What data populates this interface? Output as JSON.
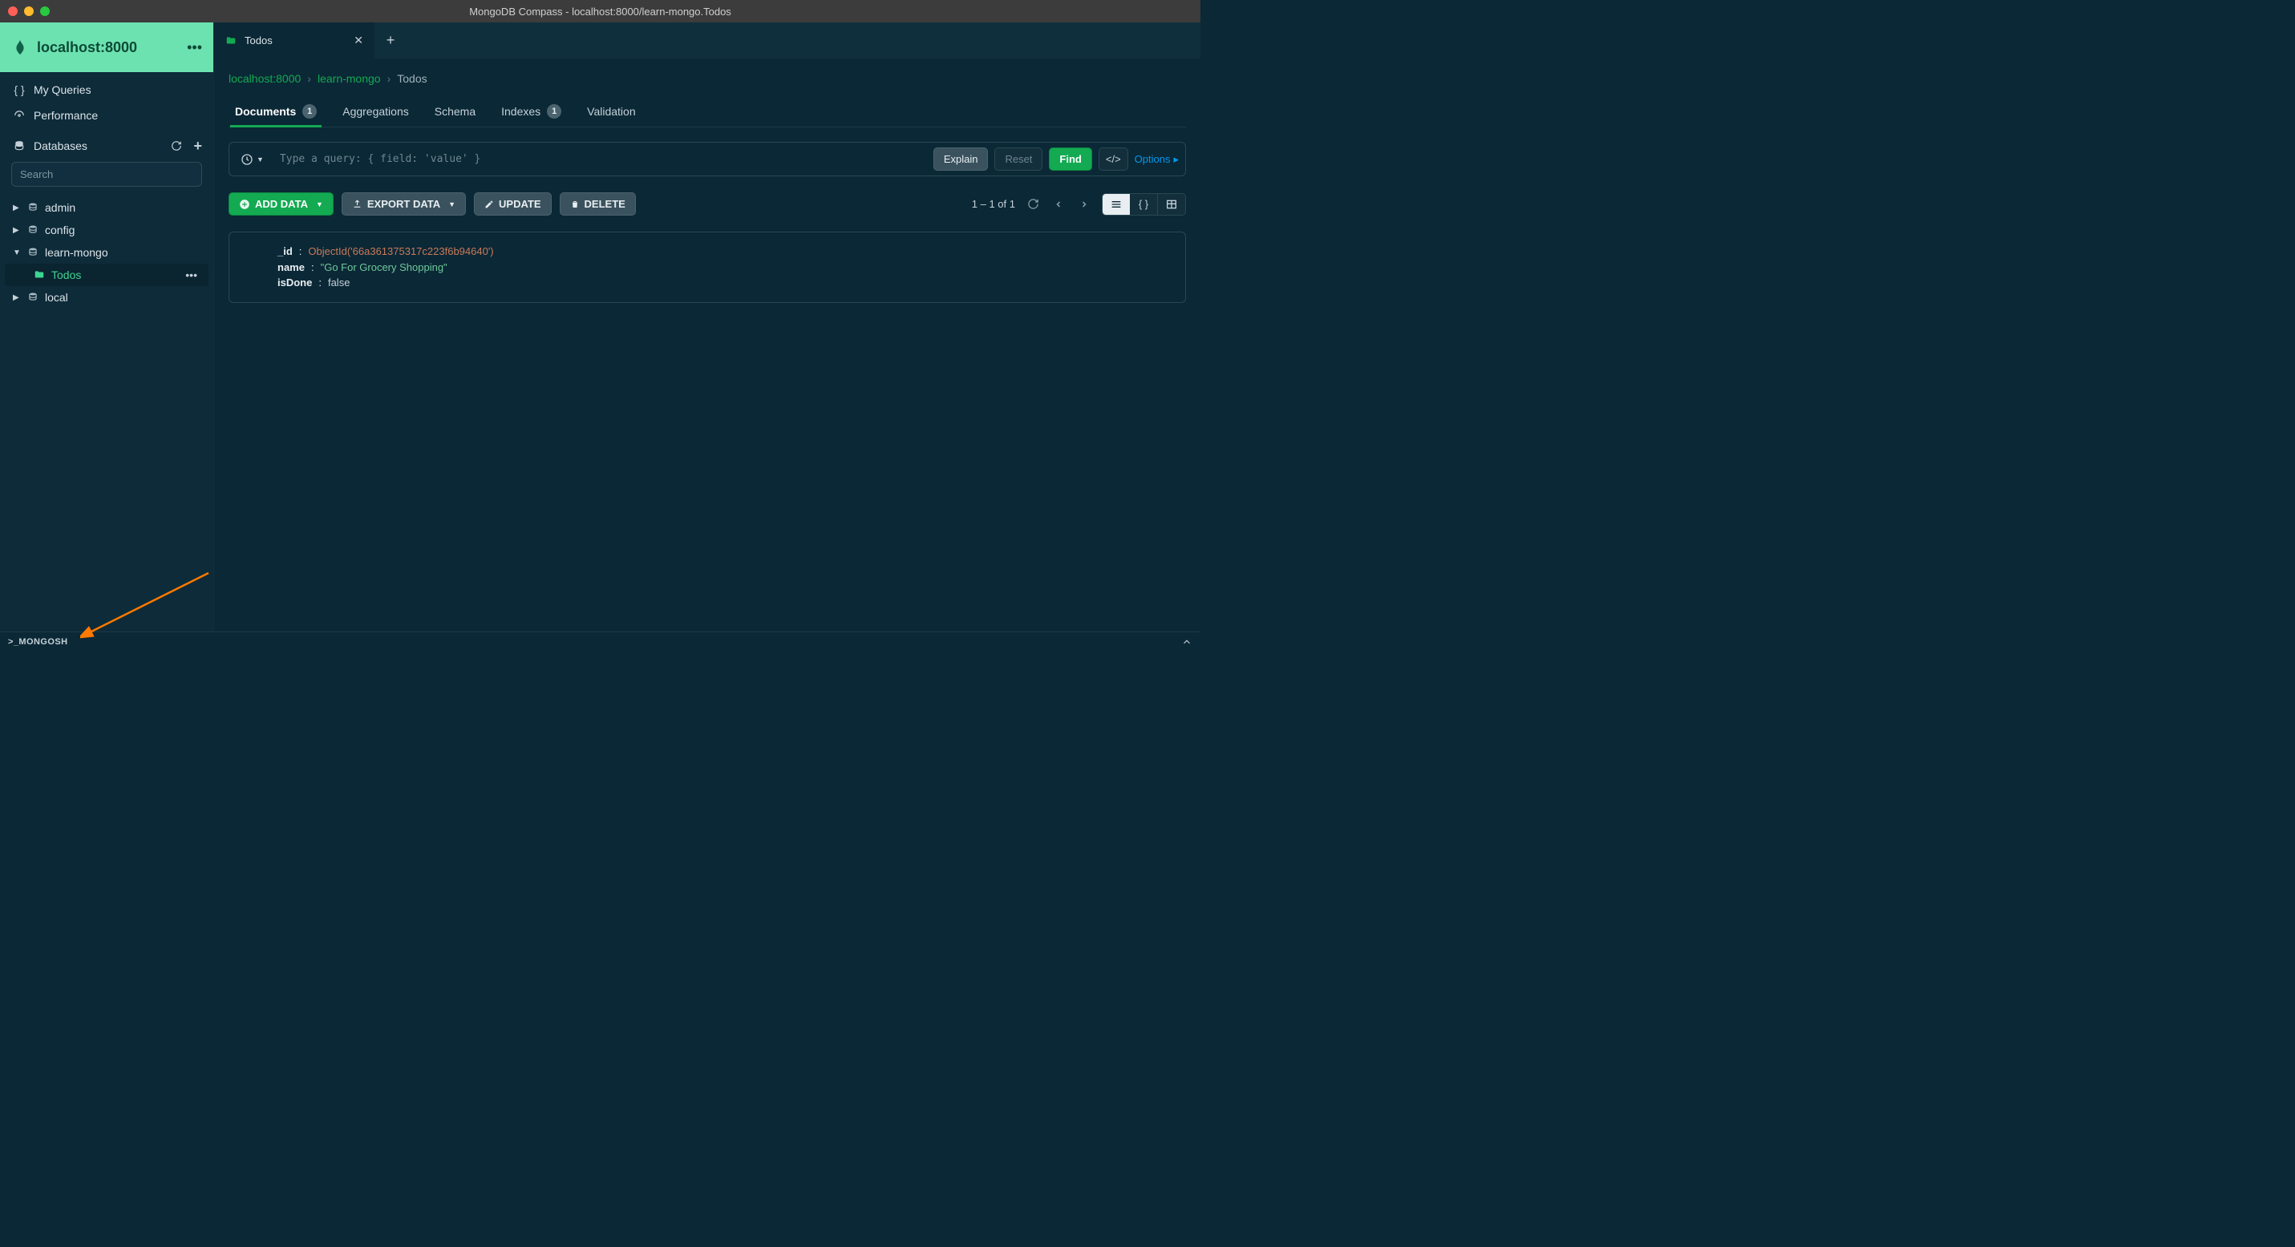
{
  "window": {
    "title": "MongoDB Compass - localhost:8000/learn-mongo.Todos"
  },
  "sidebar": {
    "connection": {
      "name": "localhost:8000"
    },
    "nav": {
      "my_queries": "My Queries",
      "performance": "Performance",
      "databases": "Databases"
    },
    "search_placeholder": "Search",
    "databases": [
      {
        "name": "admin",
        "expanded": false
      },
      {
        "name": "config",
        "expanded": false
      },
      {
        "name": "learn-mongo",
        "expanded": true,
        "collections": [
          {
            "name": "Todos",
            "selected": true
          }
        ]
      },
      {
        "name": "local",
        "expanded": false
      }
    ]
  },
  "tabs": [
    {
      "label": "Todos"
    }
  ],
  "breadcrumb": {
    "host": "localhost:8000",
    "db": "learn-mongo",
    "collection": "Todos"
  },
  "docTabs": {
    "documents": {
      "label": "Documents",
      "count": "1"
    },
    "aggregations": {
      "label": "Aggregations"
    },
    "schema": {
      "label": "Schema"
    },
    "indexes": {
      "label": "Indexes",
      "count": "1"
    },
    "validation": {
      "label": "Validation"
    }
  },
  "queryBar": {
    "placeholder": "Type a query: { field: 'value' }",
    "explain": "Explain",
    "reset": "Reset",
    "find": "Find",
    "options": "Options"
  },
  "toolbar": {
    "addData": "ADD DATA",
    "exportData": "EXPORT DATA",
    "update": "UPDATE",
    "delete": "DELETE",
    "pageInfo": "1 – 1 of 1"
  },
  "document": {
    "id_key": "_id",
    "id_value": "ObjectId('66a361375317c223f6b94640')",
    "name_key": "name",
    "name_value": "\"Go For Grocery Shopping\"",
    "isDone_key": "isDone",
    "isDone_value": "false"
  },
  "footer": {
    "mongosh": ">_MONGOSH"
  }
}
